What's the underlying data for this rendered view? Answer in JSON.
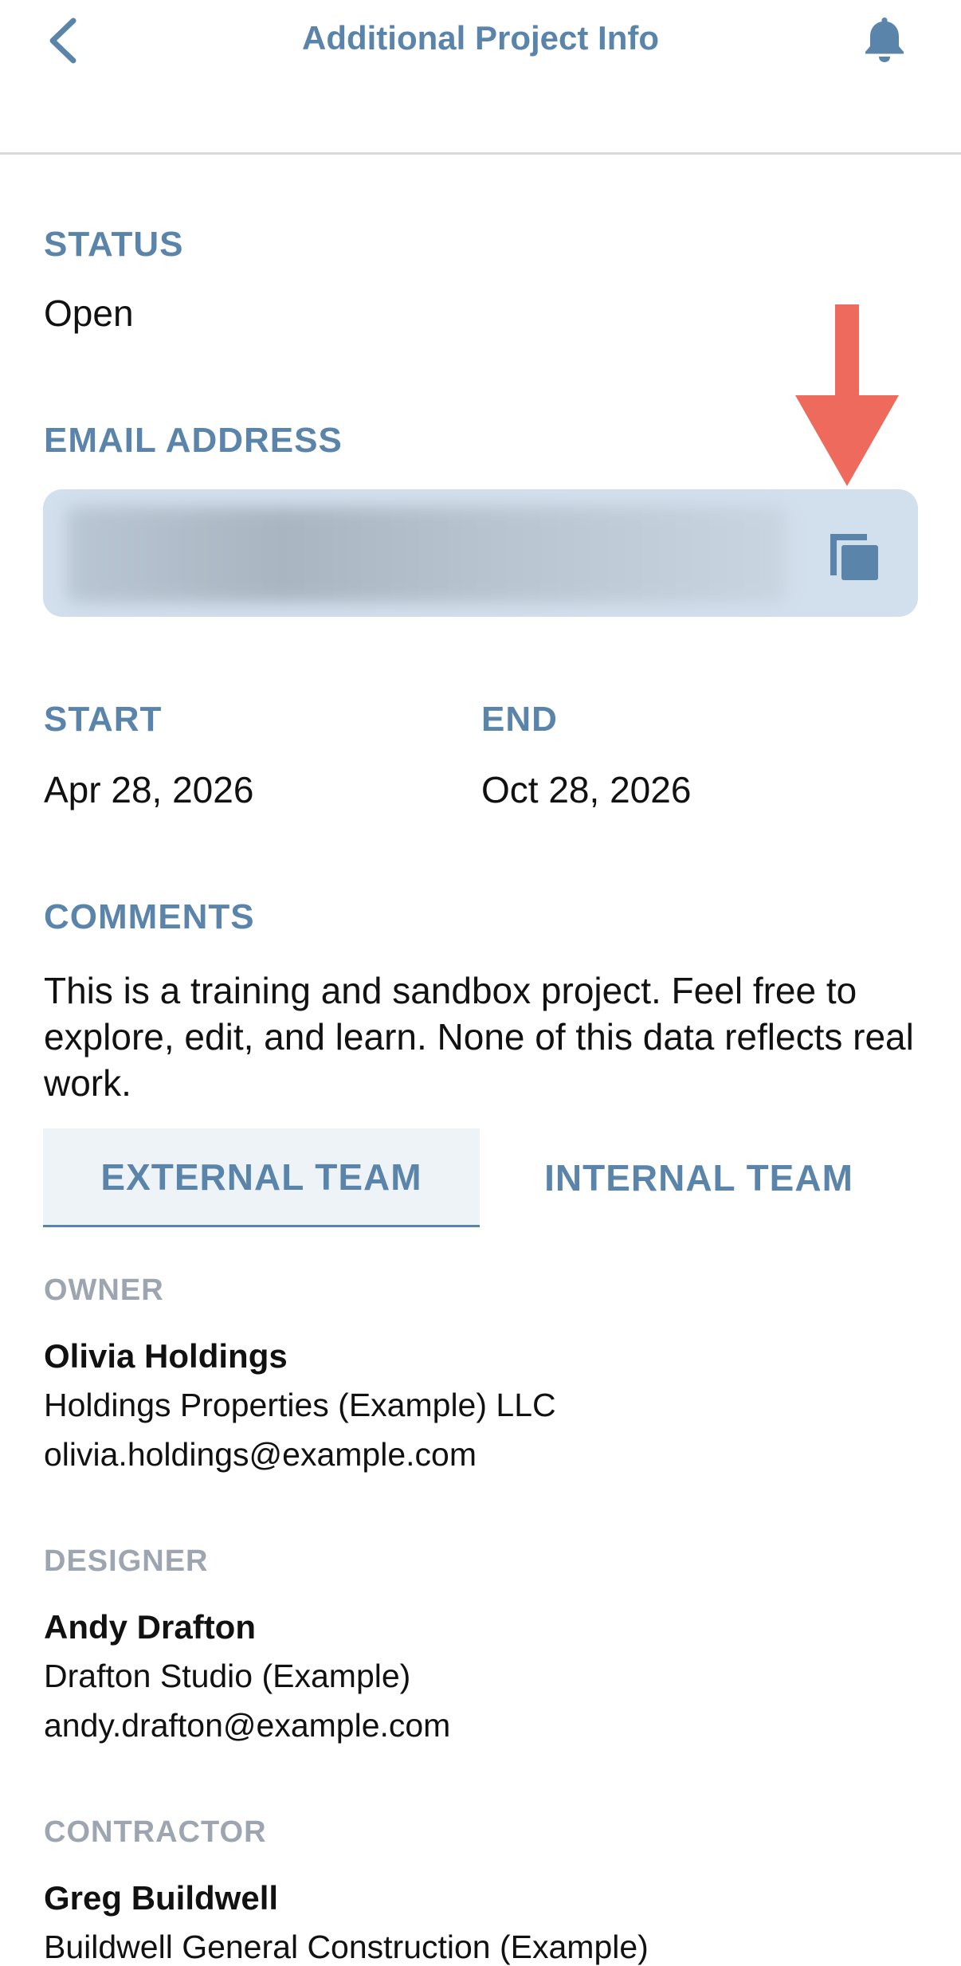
{
  "header": {
    "title": "Additional Project Info",
    "back_icon": "chevron-left-icon",
    "notification_icon": "bell-icon"
  },
  "status": {
    "label": "STATUS",
    "value": "Open"
  },
  "email": {
    "label": "EMAIL ADDRESS",
    "copy_icon": "copy-icon",
    "annotation_icon": "red-arrow-down"
  },
  "dates": {
    "start_label": "START",
    "start_value": "Apr 28, 2026",
    "end_label": "END",
    "end_value": "Oct 28, 2026"
  },
  "comments": {
    "label": "COMMENTS",
    "text": "This is a training and sandbox project. Feel free to explore, edit, and learn. None of this data reflects real work."
  },
  "tabs": [
    {
      "label": "EXTERNAL TEAM",
      "selected": true
    },
    {
      "label": "INTERNAL TEAM",
      "selected": false
    }
  ],
  "team": [
    {
      "role": "OWNER",
      "name": "Olivia Holdings",
      "company": "Holdings Properties (Example) LLC",
      "email": "olivia.holdings@example.com"
    },
    {
      "role": "DESIGNER",
      "name": "Andy Drafton",
      "company": "Drafton Studio (Example)",
      "email": "andy.drafton@example.com"
    },
    {
      "role": "CONTRACTOR",
      "name": "Greg Buildwell",
      "company": "Buildwell General Construction (Example)"
    }
  ],
  "colors": {
    "accent": "#5b84aa",
    "email_box": "#d2dfec",
    "annotation_arrow": "#ee6a5c",
    "role_label": "#9da6b0"
  }
}
